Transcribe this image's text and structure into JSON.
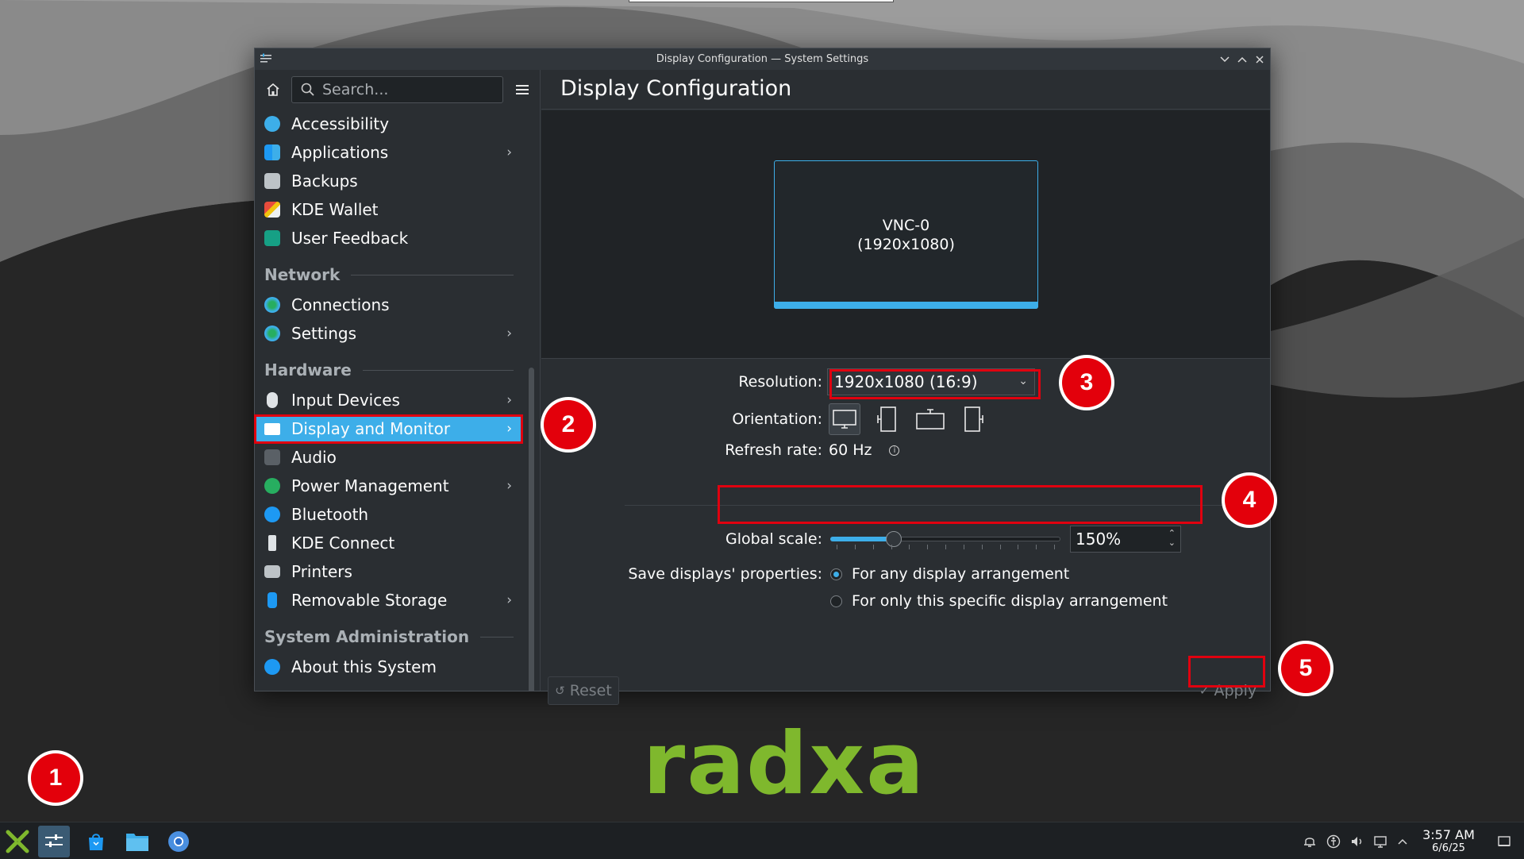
{
  "window": {
    "title": "Display Configuration — System Settings"
  },
  "sidebar": {
    "search_placeholder": "Search...",
    "groups": [
      {
        "items": [
          {
            "label": "Accessibility",
            "icon": "accessibility-icon",
            "chevron": false
          },
          {
            "label": "Applications",
            "icon": "applications-icon",
            "chevron": true
          },
          {
            "label": "Backups",
            "icon": "backups-icon",
            "chevron": false
          },
          {
            "label": "KDE Wallet",
            "icon": "kde-wallet-icon",
            "chevron": false
          },
          {
            "label": "User Feedback",
            "icon": "user-feedback-icon",
            "chevron": false
          }
        ]
      }
    ],
    "sections": {
      "network": "Network",
      "hardware": "Hardware",
      "sysadmin": "System Administration"
    },
    "network_items": [
      {
        "label": "Connections",
        "chevron": false
      },
      {
        "label": "Settings",
        "chevron": true
      }
    ],
    "hardware_items": [
      {
        "label": "Input Devices",
        "chevron": true
      },
      {
        "label": "Display and Monitor",
        "chevron": true,
        "selected": true
      },
      {
        "label": "Audio",
        "chevron": false
      },
      {
        "label": "Power Management",
        "chevron": true
      },
      {
        "label": "Bluetooth",
        "chevron": false
      },
      {
        "label": "KDE Connect",
        "chevron": false
      },
      {
        "label": "Printers",
        "chevron": false
      },
      {
        "label": "Removable Storage",
        "chevron": true
      }
    ],
    "sysadmin_items": [
      {
        "label": "About this System",
        "chevron": false
      }
    ]
  },
  "content": {
    "page_title": "Display Configuration",
    "monitor": {
      "name": "VNC-0",
      "resolution": "(1920x1080)"
    },
    "resolution_label": "Resolution:",
    "resolution_value": "1920x1080 (16:9)",
    "orientation_label": "Orientation:",
    "refresh_label": "Refresh rate:",
    "refresh_value": "60 Hz",
    "scale_label": "Global scale:",
    "scale_value": "150%",
    "scale_slider_fraction": 0.26,
    "save_label": "Save displays' properties:",
    "save_option_any": "For any display arrangement",
    "save_option_specific": "For only this specific display arrangement",
    "save_selected": "any",
    "reset_label": "Reset",
    "apply_label": "Apply"
  },
  "annotations": [
    "1",
    "2",
    "3",
    "4",
    "5"
  ],
  "logo_text": "radxa",
  "taskbar": {
    "time": "3:57 AM",
    "date": "6/6/25"
  },
  "colors": {
    "accent": "#3daee9",
    "highlight": "#e0000f",
    "logo": "#7fb82d"
  }
}
